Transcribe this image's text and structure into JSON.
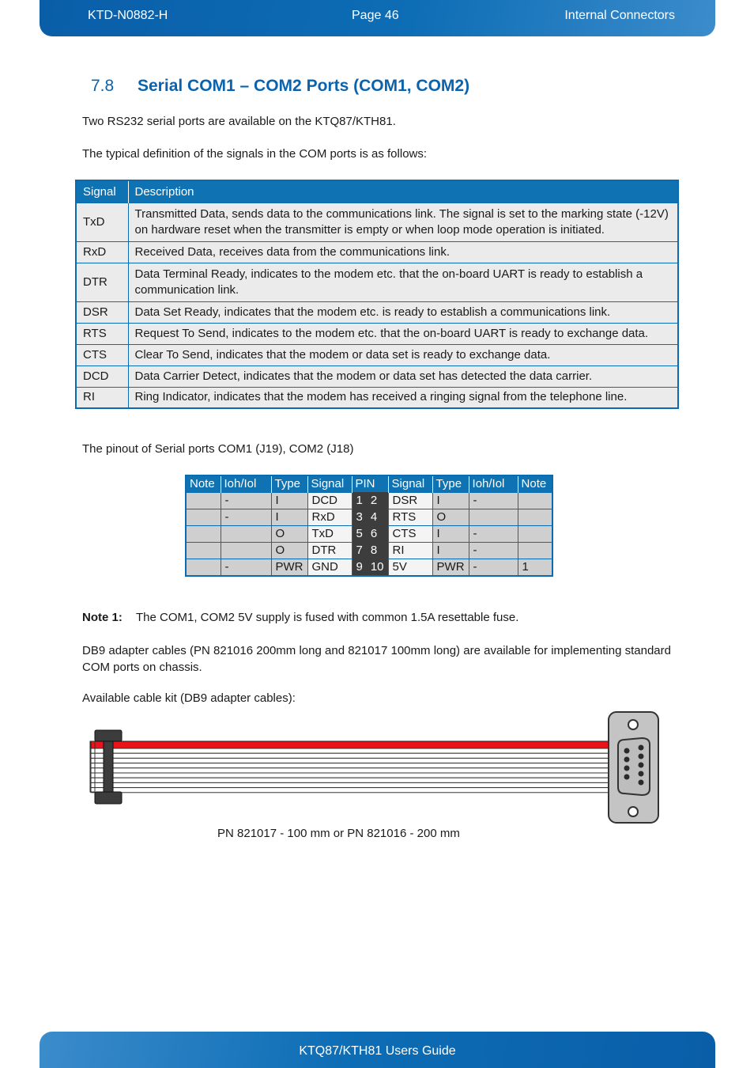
{
  "header": {
    "doc_id": "KTD-N0882-H",
    "page": "Page 46",
    "chapter": "Internal Connectors"
  },
  "footer": {
    "title": "KTQ87/KTH81 Users Guide"
  },
  "section": {
    "number": "7.8",
    "title": "Serial COM1 – COM2 Ports (COM1, COM2)"
  },
  "intro": {
    "p1": "Two RS232 serial ports are available on the KTQ87/KTH81.",
    "p2": "The typical definition of the signals in the COM ports is as follows:"
  },
  "signal_table": {
    "headers": [
      "Signal",
      "Description"
    ],
    "rows": [
      {
        "signal": "TxD",
        "description": "Transmitted Data, sends data to the communications link. The signal is set to the marking state (-12V) on hardware reset when the transmitter is empty or when loop mode operation is initiated."
      },
      {
        "signal": "RxD",
        "description": "Received Data, receives data from the communications link."
      },
      {
        "signal": "DTR",
        "description": "Data Terminal Ready, indicates to the modem etc. that the on-board UART is ready to establish a communication link."
      },
      {
        "signal": "DSR",
        "description": "Data Set Ready, indicates that the modem etc. is ready to establish a communications link."
      },
      {
        "signal": "RTS",
        "description": "Request To Send, indicates to the modem etc. that the on-board UART is ready to exchange data."
      },
      {
        "signal": "CTS",
        "description": "Clear To Send, indicates that the modem or data set is ready to exchange data."
      },
      {
        "signal": "DCD",
        "description": "Data Carrier Detect, indicates that the modem or data set has detected the data carrier."
      },
      {
        "signal": "RI",
        "description": "Ring Indicator, indicates that the modem has received a ringing signal from the telephone line."
      }
    ]
  },
  "pinout_intro": "The pinout of Serial ports COM1 (J19), COM2 (J18)",
  "pinout_table": {
    "headers": [
      "Note",
      "Ioh/Iol",
      "Type",
      "Signal",
      "PIN",
      "Signal",
      "Type",
      "Ioh/Iol",
      "Note"
    ],
    "rows": [
      {
        "note_l": "",
        "ioh_l": "-",
        "type_l": "I",
        "signal_l": "DCD",
        "pin_l": "1",
        "pin_r": "2",
        "signal_r": "DSR",
        "type_r": "I",
        "ioh_r": "-",
        "note_r": ""
      },
      {
        "note_l": "",
        "ioh_l": "-",
        "type_l": "I",
        "signal_l": "RxD",
        "pin_l": "3",
        "pin_r": "4",
        "signal_r": "RTS",
        "type_r": "O",
        "ioh_r": "",
        "note_r": ""
      },
      {
        "note_l": "",
        "ioh_l": "",
        "type_l": "O",
        "signal_l": "TxD",
        "pin_l": "5",
        "pin_r": "6",
        "signal_r": "CTS",
        "type_r": "I",
        "ioh_r": "-",
        "note_r": ""
      },
      {
        "note_l": "",
        "ioh_l": "",
        "type_l": "O",
        "signal_l": "DTR",
        "pin_l": "7",
        "pin_r": "8",
        "signal_r": "RI",
        "type_r": "I",
        "ioh_r": "-",
        "note_r": ""
      },
      {
        "note_l": "",
        "ioh_l": "-",
        "type_l": "PWR",
        "signal_l": "GND",
        "pin_l": "9",
        "pin_r": "10",
        "signal_r": "5V",
        "type_r": "PWR",
        "ioh_r": "-",
        "note_r": "1"
      }
    ]
  },
  "note1": {
    "label": "Note 1:",
    "text": "The COM1, COM2 5V supply is fused with common 1.5A resettable fuse."
  },
  "db9_paragraph": "DB9 adapter cables (PN 821016 200mm long and 821017 100mm long) are available for implementing standard COM ports on chassis.",
  "cable_kit_label": "Available cable kit (DB9 adapter cables):",
  "cable_figure": {
    "caption": "PN 821017 - 100 mm or PN 821016 - 200 mm",
    "colors": {
      "wire_red": "#e8141a",
      "connector_dark": "#3c3c3c",
      "db9_plate": "#c4c4c4"
    }
  }
}
